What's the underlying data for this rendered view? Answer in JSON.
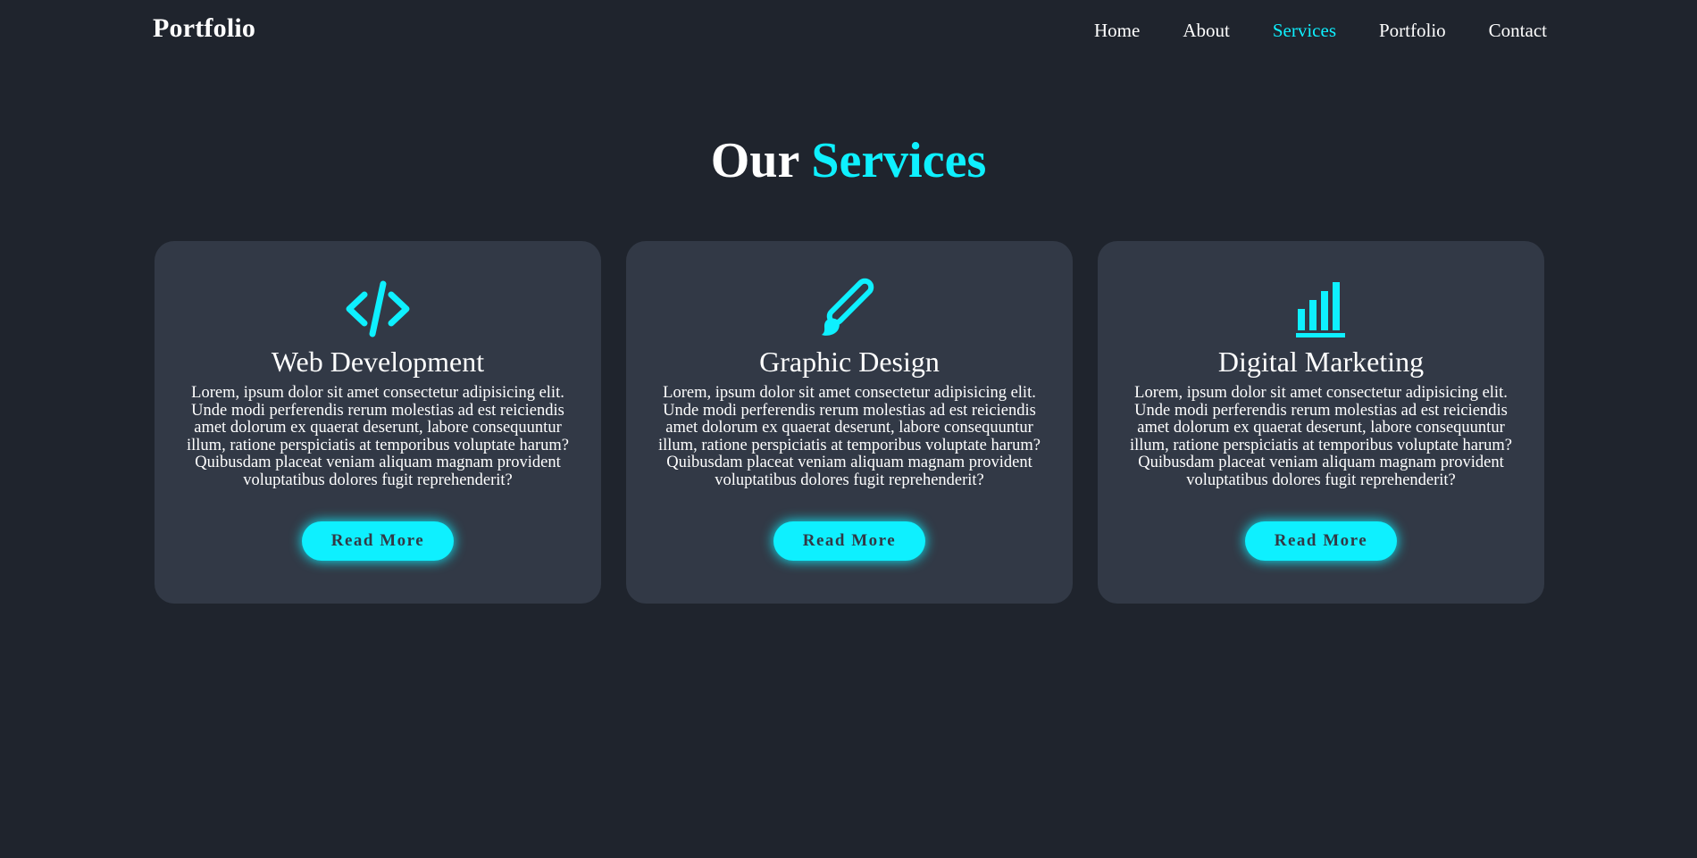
{
  "header": {
    "logo": "Portfolio",
    "nav": [
      {
        "label": "Home",
        "active": false
      },
      {
        "label": "About",
        "active": false
      },
      {
        "label": "Services",
        "active": true
      },
      {
        "label": "Portfolio",
        "active": false
      },
      {
        "label": "Contact",
        "active": false
      }
    ]
  },
  "section": {
    "title_plain": "Our",
    "title_accent": "Services"
  },
  "cards": [
    {
      "icon": "code-icon",
      "title": "Web Development",
      "text": "Lorem, ipsum dolor sit amet consectetur adipisicing elit. Unde modi perferendis rerum molestias ad est reiciendis amet dolorum ex quaerat deserunt, labore consequuntur illum, ratione perspiciatis at temporibus voluptate harum? Quibusdam placeat veniam aliquam magnam provident voluptatibus dolores fugit reprehenderit?",
      "button": "Read More"
    },
    {
      "icon": "paintbrush-icon",
      "title": "Graphic Design",
      "text": "Lorem, ipsum dolor sit amet consectetur adipisicing elit. Unde modi perferendis rerum molestias ad est reiciendis amet dolorum ex quaerat deserunt, labore consequuntur illum, ratione perspiciatis at temporibus voluptate harum? Quibusdam placeat veniam aliquam magnam provident voluptatibus dolores fugit reprehenderit?",
      "button": "Read More"
    },
    {
      "icon": "bar-chart-icon",
      "title": "Digital Marketing",
      "text": "Lorem, ipsum dolor sit amet consectetur adipisicing elit. Unde modi perferendis rerum molestias ad est reiciendis amet dolorum ex quaerat deserunt, labore consequuntur illum, ratione perspiciatis at temporibus voluptate harum? Quibusdam placeat veniam aliquam magnam provident voluptatibus dolores fugit reprehenderit?",
      "button": "Read More"
    }
  ],
  "colors": {
    "background": "#1f242d",
    "card": "#323946",
    "accent": "#0ef0ff",
    "text": "#ffffff"
  }
}
